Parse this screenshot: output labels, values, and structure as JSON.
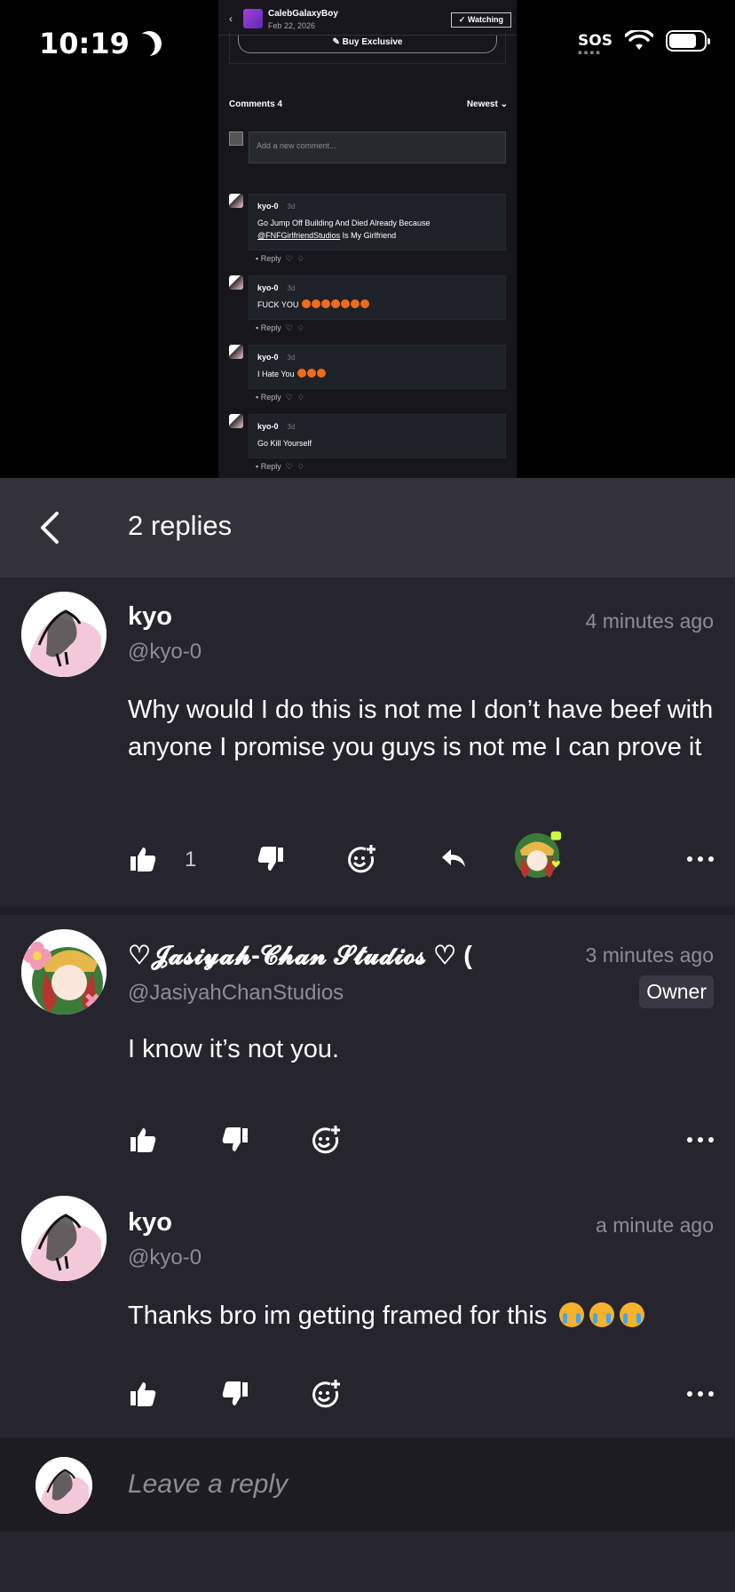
{
  "status_bar": {
    "time": "10:19",
    "sos": "SOS"
  },
  "embed": {
    "channel": "CalebGalaxyBoy",
    "date": "Feb 22, 2026",
    "watching": "✓ Watching",
    "buy": "Buy Exclusive",
    "comments_label": "Comments 4",
    "sort": "Newest",
    "input_placeholder": "Add a new comment...",
    "comments": [
      {
        "user": "kyo-0",
        "ago": "3d",
        "text_pre": "Go Jump Off Building And Died Already Because",
        "link": "@FNFGirlfriendStudios",
        "text_post": " Is My Girlfriend"
      },
      {
        "user": "kyo-0",
        "ago": "3d",
        "text": "FUCK YOU"
      },
      {
        "user": "kyo-0",
        "ago": "3d",
        "text": "I Hate You"
      },
      {
        "user": "kyo-0",
        "ago": "3d",
        "text": "Go Kill Yourself"
      }
    ],
    "reply_label": "Reply"
  },
  "header": {
    "title": "2 replies"
  },
  "replies": [
    {
      "name": "kyo",
      "handle": "@kyo-0",
      "time": "4 minutes ago",
      "text": "Why would I do this is not me I don’t have beef with anyone I promise you guys is not me I can prove it",
      "likes": "1"
    },
    {
      "name": "♡𝓙𝓪𝓼𝓲𝔂𝓪𝓱-𝓒𝓱𝓪𝓷 𝓢𝓽𝓾𝓭𝓲𝓸𝓼 ♡ (",
      "handle": "@JasiyahChanStudios",
      "time": "3 minutes ago",
      "badge": "Owner",
      "text": "I know it’s not you."
    },
    {
      "name": "kyo",
      "handle": "@kyo-0",
      "time": "a minute ago",
      "text": "Thanks bro im getting framed for this"
    }
  ],
  "reply_bar": {
    "placeholder": "Leave a reply"
  }
}
